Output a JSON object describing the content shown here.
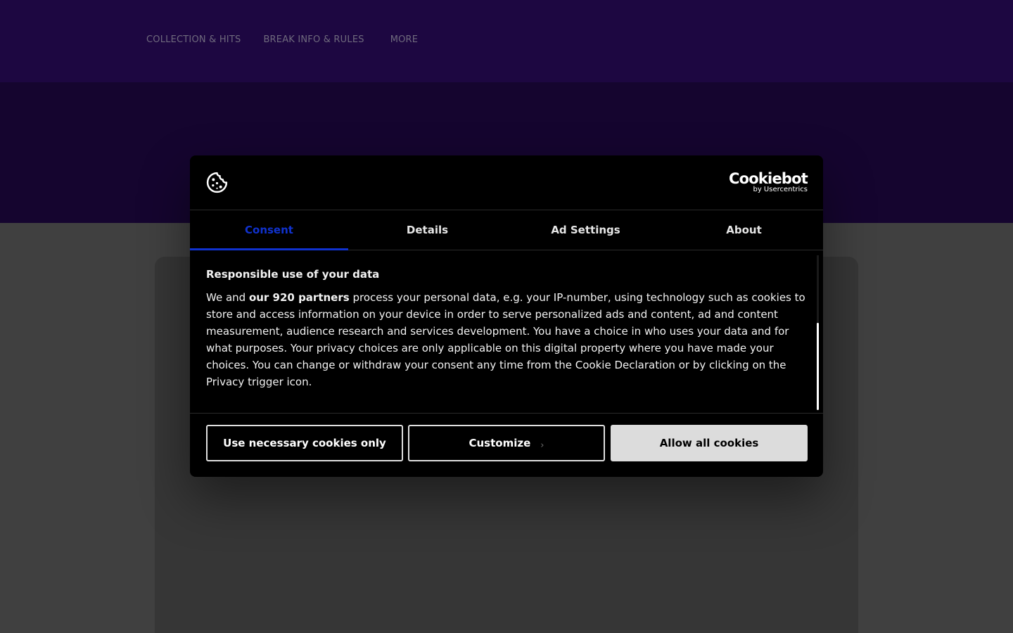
{
  "nav": {
    "links": [
      "COLLECTION & HITS",
      "BREAK INFO & RULES",
      "MORE"
    ]
  },
  "dialog": {
    "icon": "cookie-icon",
    "brand": {
      "name": "Cookiebot",
      "sub": "by Usercentrics"
    },
    "tabs": [
      {
        "label": "Consent",
        "active": true
      },
      {
        "label": "Details",
        "active": false
      },
      {
        "label": "Ad Settings",
        "active": false
      },
      {
        "label": "About",
        "active": false
      }
    ],
    "body": {
      "title": "Responsible use of your data",
      "para_before": "We and ",
      "para_bold": "our 920 partners",
      "para_after": " process your personal data, e.g. your IP-number, using technology such as cookies to store and access information on your device in order to serve personalized ads and content, ad and content measurement, audience research and services development. You have a choice in who uses your data and for what purposes. Your privacy choices are only applicable on this digital property where you have made your choices. You can change or withdraw your consent any time from the Cookie Declaration or by clicking on the Privacy trigger icon."
    },
    "buttons": {
      "necessary": "Use necessary cookies only",
      "customize": "Customize",
      "customize_icon": "chevron-right-icon",
      "allow": "Allow all cookies"
    }
  },
  "colors": {
    "nav_bg": "#1d0741",
    "hero_bg": "#15052f",
    "accent": "#1032cf",
    "dialog_bg": "#000000",
    "allow_bg": "#dcdcdc"
  }
}
